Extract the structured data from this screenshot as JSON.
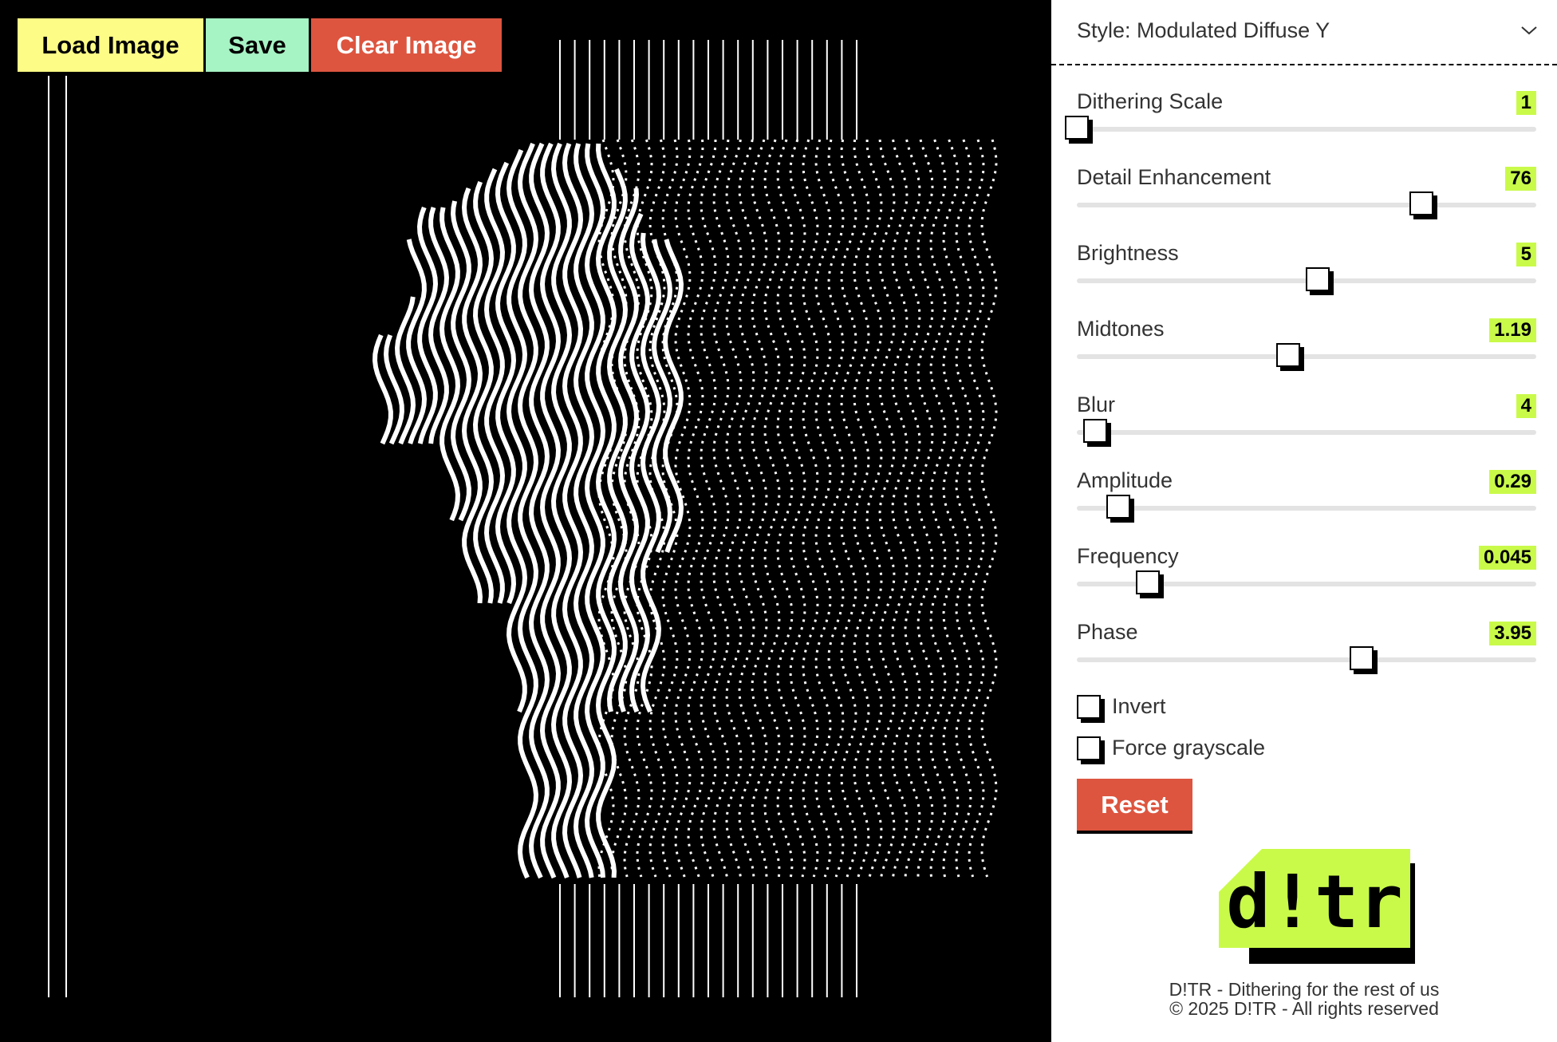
{
  "toolbar": {
    "load_label": "Load Image",
    "save_label": "Save",
    "clear_label": "Clear Image"
  },
  "colors": {
    "load_bg": "#fdfc86",
    "save_bg": "#a6f3c4",
    "clear_bg": "#dd553f",
    "value_badge_bg": "#c9fa4a",
    "logo_green": "#c9fa4a"
  },
  "settings": {
    "style_label": "Style: Modulated Diffuse Y",
    "sliders": [
      {
        "label": "Dithering Scale",
        "value": "1",
        "fraction": 0.0
      },
      {
        "label": "Detail Enhancement",
        "value": "76",
        "fraction": 0.75
      },
      {
        "label": "Brightness",
        "value": "5",
        "fraction": 0.525
      },
      {
        "label": "Midtones",
        "value": "1.19",
        "fraction": 0.46
      },
      {
        "label": "Blur",
        "value": "4",
        "fraction": 0.04
      },
      {
        "label": "Amplitude",
        "value": "0.29",
        "fraction": 0.09
      },
      {
        "label": "Frequency",
        "value": "0.045",
        "fraction": 0.155
      },
      {
        "label": "Phase",
        "value": "3.95",
        "fraction": 0.62
      }
    ],
    "invert_label": "Invert",
    "invert_checked": false,
    "grayscale_label": "Force grayscale",
    "grayscale_checked": false,
    "reset_label": "Reset"
  },
  "logo_text": "d!tr",
  "footer": {
    "line1": "D!TR - Dithering for the rest of us",
    "line2": "© 2025 D!TR - All rights reserved"
  }
}
